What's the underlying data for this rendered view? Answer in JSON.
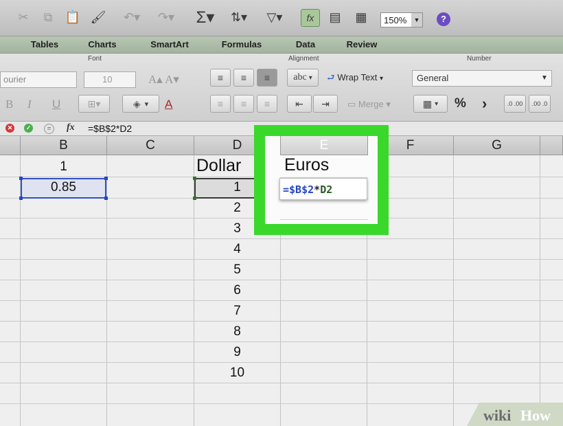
{
  "toolbar": {
    "zoom": "150%",
    "icons": [
      "cut-icon",
      "copy-icon",
      "paste-icon",
      "format-painter-icon",
      "undo-icon",
      "redo-icon",
      "autosum-icon",
      "sort-icon",
      "filter-icon",
      "formula-builder-icon",
      "show-hide-icon",
      "gallery-icon",
      "help-icon"
    ]
  },
  "tabs": [
    "Tables",
    "Charts",
    "SmartArt",
    "Formulas",
    "Data",
    "Review"
  ],
  "ribbon": {
    "font_group": "Font",
    "font_name": "ourier",
    "font_size": "10",
    "alignment_group": "Alignment",
    "abc": "abc",
    "wrap_text": "Wrap Text",
    "merge": "Merge",
    "number_group": "Number",
    "number_format": "General",
    "percent": "%",
    "comma": "›"
  },
  "formula_bar": {
    "fx": "fx",
    "formula": "=$B$2*D2"
  },
  "columns": [
    "B",
    "C",
    "D",
    "E",
    "F",
    "G"
  ],
  "cells": {
    "B1": "1",
    "B2": "0.85",
    "D1": "Dollar",
    "E1": "Euros",
    "D_values": [
      "1",
      "2",
      "3",
      "4",
      "5",
      "6",
      "7",
      "8",
      "9",
      "10"
    ]
  },
  "popup": {
    "ref1": "=$B$2",
    "op": "*",
    "ref2": "D2"
  },
  "watermark": {
    "part1": "wiki",
    "part2": "How"
  },
  "colors": {
    "highlight": "#3ad82b",
    "ref_blue": "#2346c8",
    "ref_green": "#2a7a1e"
  }
}
